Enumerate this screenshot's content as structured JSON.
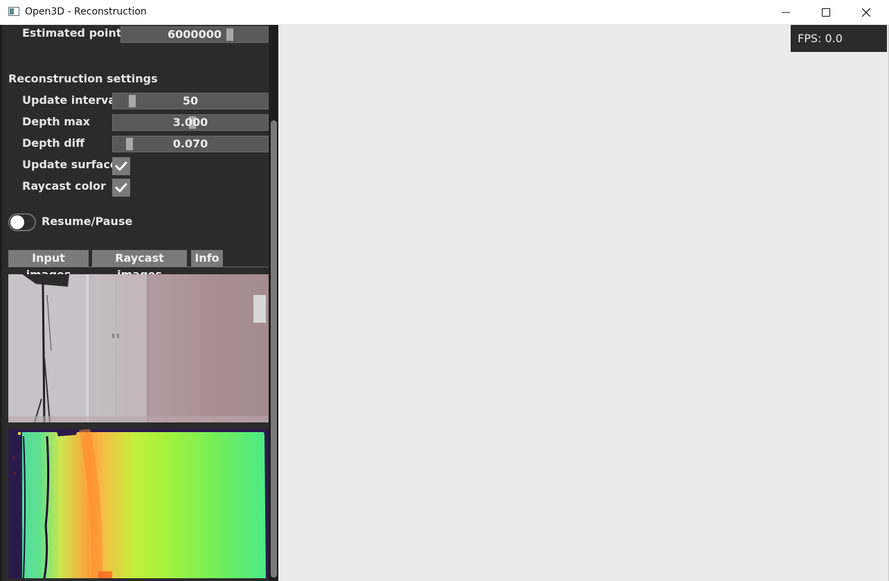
{
  "window": {
    "title": "Open3D - Reconstruction"
  },
  "panel": {
    "estimated_points": {
      "label": "Estimated points",
      "value": "6000000"
    },
    "reconstruction_settings": {
      "title": "Reconstruction settings",
      "update_interval": {
        "label": "Update interval",
        "value": "50"
      },
      "depth_max": {
        "label": "Depth max",
        "value": "3.000"
      },
      "depth_diff": {
        "label": "Depth diff",
        "value": "0.070"
      },
      "update_surface": {
        "label": "Update surface",
        "checked": true
      },
      "raycast_color": {
        "label": "Raycast color",
        "checked": true
      }
    },
    "resume_pause": {
      "label": "Resume/Pause",
      "on": false
    },
    "tabs": [
      {
        "label": "Input images",
        "active": true
      },
      {
        "label": "Raycast images",
        "active": false
      },
      {
        "label": "Info",
        "active": false
      }
    ]
  },
  "viewport": {
    "fps_label": "FPS: 0.0"
  },
  "colors": {
    "panel_bg": "#2b2b2b",
    "viewport_bg": "#ebebeb",
    "control_bg": "#595959",
    "checkbox_bg": "#7a7a7a"
  }
}
